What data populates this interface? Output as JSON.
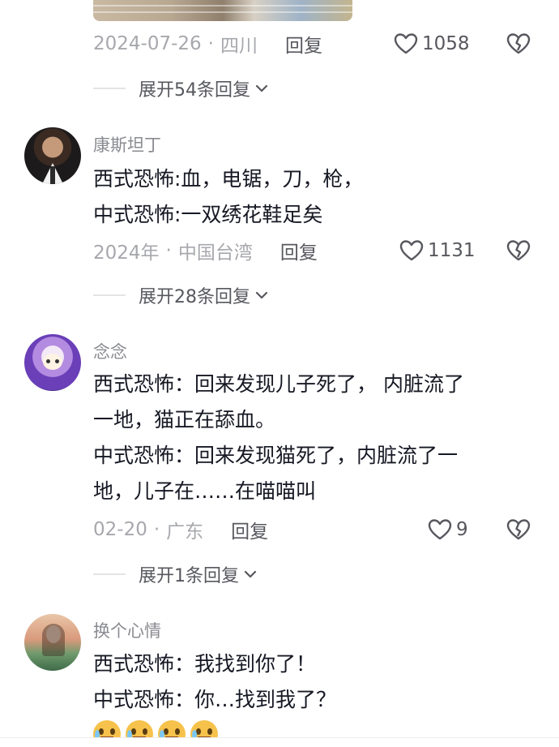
{
  "comment0": {
    "date": "2024-07-26",
    "location": "四川",
    "reply_label": "回复",
    "like_count": "1058",
    "expand_label": "展开54条回复"
  },
  "comment1": {
    "username": "康斯坦丁",
    "lines": [
      "西式恐怖:血，电锯，刀，枪，",
      "中式恐怖:一双绣花鞋足矣"
    ],
    "date": "2024年",
    "location": "中国台湾",
    "reply_label": "回复",
    "like_count": "1131",
    "expand_label": "展开28条回复"
  },
  "comment2": {
    "username": "念念",
    "lines": [
      "西式恐怖：回来发现儿子死了， 内脏流了",
      "一地，猫正在舔血。",
      "中式恐怖：回来发现猫死了，内脏流了一",
      "地，儿子在……在喵喵叫"
    ],
    "date": "02-20",
    "location": "广东",
    "reply_label": "回复",
    "like_count": "9",
    "expand_label": "展开1条回复"
  },
  "comment3": {
    "username": "换个心情",
    "lines": [
      "西式恐怖：我找到你了！",
      "中式恐怖：你…找到我了？"
    ]
  },
  "colors": {
    "text_primary": "#161823",
    "text_secondary": "#a7a8ad",
    "text_action": "#57585e"
  },
  "icons": [
    "heart-icon",
    "broken-heart-icon",
    "chevron-down-icon",
    "sweat-smile-emoji"
  ]
}
